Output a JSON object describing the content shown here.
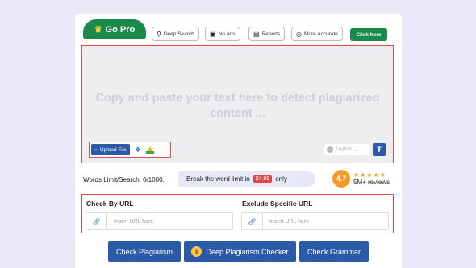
{
  "header": {
    "gopro_label": "Go Pro",
    "features": [
      {
        "icon": "search-icon",
        "label": "Deep Search"
      },
      {
        "icon": "ad-icon",
        "label": "No Ads"
      },
      {
        "icon": "report-icon",
        "label": "Reports"
      },
      {
        "icon": "target-icon",
        "label": "More Accurate"
      }
    ],
    "click_here_label": "Click here"
  },
  "editor": {
    "placeholder": "Copy and paste your text here to detect plagiarized content ...",
    "upload_label": "Upload File",
    "language": "English"
  },
  "limits": {
    "words_limit_text": "Words Limit/Search: 0/1000.",
    "break_text": "Break the word limit in",
    "price": "$4.99",
    "only_text": "only"
  },
  "rating": {
    "score": "4.7",
    "stars": "★★★★★",
    "reviews": "5M+ reviews"
  },
  "url_section": {
    "check_by_url_label": "Check By URL",
    "exclude_label": "Exclude Specific URL",
    "check_placeholder": "Insert URL here",
    "exclude_placeholder": "Insert URL here"
  },
  "actions": {
    "check_plagiarism": "Check Plagiarism",
    "deep_checker": "Deep Plagiarism Checker",
    "check_grammar": "Check Grammar"
  },
  "colors": {
    "brand_green": "#1a8a4a",
    "primary_blue": "#2a5aa8",
    "accent_orange": "#f29b28",
    "border_red": "#e24a4a"
  }
}
